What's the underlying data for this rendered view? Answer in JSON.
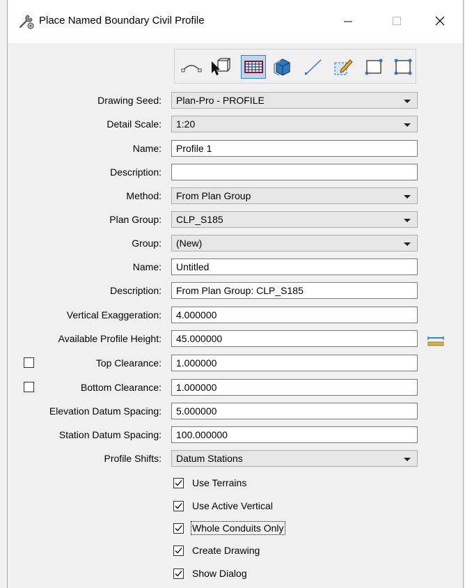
{
  "window": {
    "title": "Place Named Boundary Civil Profile",
    "icon": "wrench-gear-icon",
    "controls": [
      "minimize",
      "maximize",
      "close"
    ]
  },
  "toolbar": {
    "tools": [
      {
        "name": "civil-plan-tool",
        "icon": "arc-curve-icon",
        "active": false
      },
      {
        "name": "select-element-tool",
        "icon": "arrow-cube-icon",
        "active": false
      },
      {
        "name": "civil-profile-tool",
        "icon": "profile-grid-icon",
        "active": true
      },
      {
        "name": "cross-section-tool",
        "icon": "cube-section-icon",
        "active": false
      },
      {
        "name": "line-tool",
        "icon": "line-icon",
        "active": false
      },
      {
        "name": "pencil-tool",
        "icon": "pencil-box-icon",
        "active": false
      },
      {
        "name": "two-point-tool",
        "icon": "rectangle-two-point-icon",
        "active": false
      },
      {
        "name": "shape-tool",
        "icon": "rectangle-four-point-icon",
        "active": false
      }
    ]
  },
  "form": {
    "drawing_seed": {
      "label": "Drawing Seed:",
      "value": "Plan-Pro - PROFILE"
    },
    "detail_scale": {
      "label": "Detail Scale:",
      "value": "1:20"
    },
    "name": {
      "label": "Name:",
      "value": "Profile 1"
    },
    "description": {
      "label": "Description:",
      "value": ""
    },
    "method": {
      "label": "Method:",
      "value": "From Plan Group"
    },
    "plan_group": {
      "label": "Plan Group:",
      "value": "CLP_S185"
    },
    "group": {
      "label": "Group:",
      "value": "(New)"
    },
    "group_name": {
      "label": "Name:",
      "value": "Untitled"
    },
    "group_description": {
      "label": "Description:",
      "value": "From Plan Group: CLP_S185"
    },
    "vertical_exaggeration": {
      "label": "Vertical Exaggeration:",
      "value": "4.000000"
    },
    "available_profile_height": {
      "label": "Available Profile Height:",
      "value": "45.000000"
    },
    "top_clearance": {
      "label": "Top Clearance:",
      "value": "1.000000",
      "checked": false
    },
    "bottom_clearance": {
      "label": "Bottom Clearance:",
      "value": "1.000000",
      "checked": false
    },
    "elevation_datum_spacing": {
      "label": "Elevation Datum Spacing:",
      "value": "5.000000"
    },
    "station_datum_spacing": {
      "label": "Station Datum Spacing:",
      "value": "100.000000"
    },
    "profile_shifts": {
      "label": "Profile Shifts:",
      "value": "Datum Stations"
    }
  },
  "options": {
    "use_terrains": {
      "label": "Use Terrains",
      "checked": true
    },
    "use_active_vertical": {
      "label": "Use Active Vertical",
      "checked": true
    },
    "whole_conduits_only": {
      "label": "Whole Conduits Only",
      "checked": true
    },
    "create_drawing": {
      "label": "Create Drawing",
      "checked": true
    },
    "show_dialog": {
      "label": "Show Dialog",
      "checked": true
    }
  },
  "colors": {
    "active_tool_bg": "#b9d6f2",
    "ruler_icon": "#2b8ccf"
  }
}
